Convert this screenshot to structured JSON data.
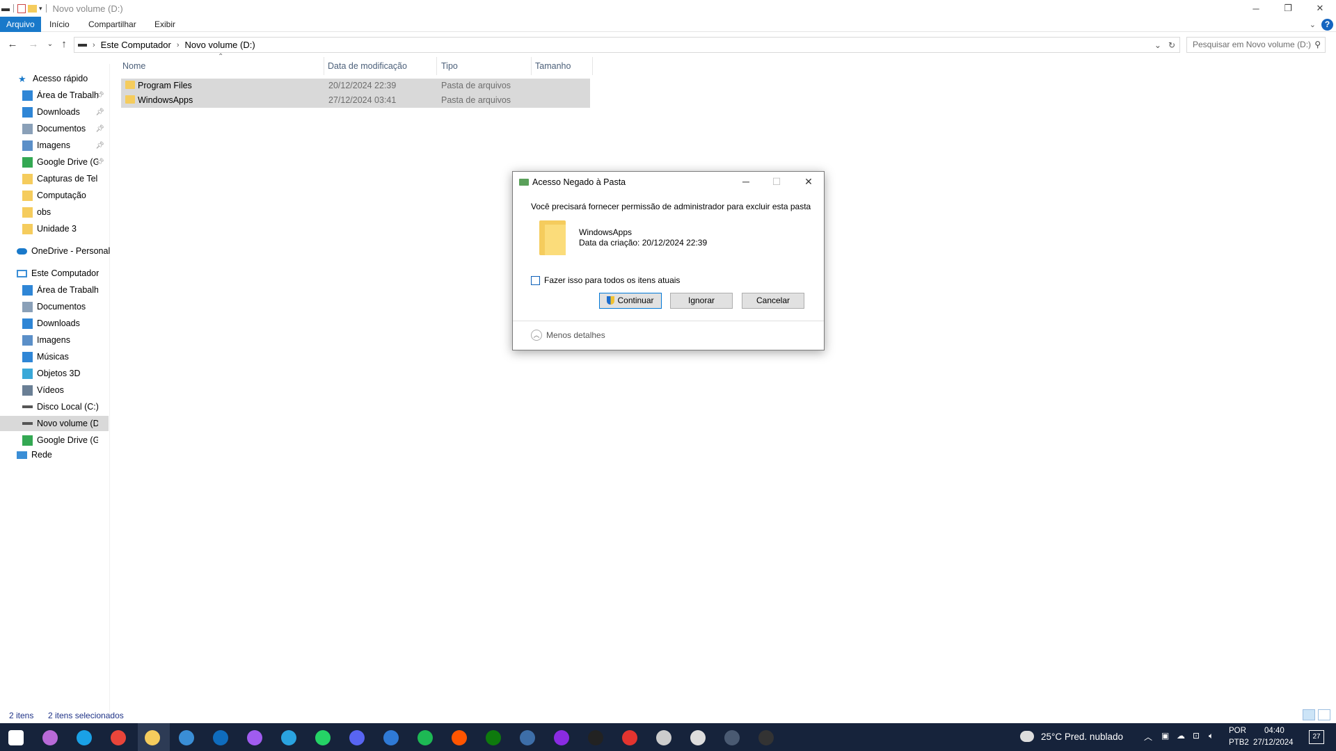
{
  "window": {
    "title": "Novo volume (D:)"
  },
  "ribbon": {
    "tabs": [
      "Arquivo",
      "Início",
      "Compartilhar",
      "Exibir"
    ],
    "help_label": "?"
  },
  "address": {
    "crumbs": [
      "Este Computador",
      "Novo volume (D:)"
    ],
    "search_placeholder": "Pesquisar em Novo volume (D:)"
  },
  "sidebar": {
    "quick_access_label": "Acesso rápido",
    "quick_access": [
      {
        "label": "Área de Trabalho",
        "icon": "desktop-icon",
        "pinned": true
      },
      {
        "label": "Downloads",
        "icon": "download-icon",
        "pinned": true
      },
      {
        "label": "Documentos",
        "icon": "documents-icon",
        "pinned": true
      },
      {
        "label": "Imagens",
        "icon": "pictures-icon",
        "pinned": true
      },
      {
        "label": "Google Drive (G:",
        "icon": "google-drive-icon",
        "pinned": true
      },
      {
        "label": "Capturas de Tela",
        "icon": "folder-icon",
        "pinned": false
      },
      {
        "label": "Computação",
        "icon": "folder-icon",
        "pinned": false
      },
      {
        "label": "obs",
        "icon": "folder-icon",
        "pinned": false
      },
      {
        "label": "Unidade 3",
        "icon": "folder-icon",
        "pinned": false
      }
    ],
    "onedrive_label": "OneDrive - Personal",
    "this_pc_label": "Este Computador",
    "this_pc": [
      {
        "label": "Área de Trabalho",
        "icon": "desktop-icon"
      },
      {
        "label": "Documentos",
        "icon": "documents-icon"
      },
      {
        "label": "Downloads",
        "icon": "download-icon"
      },
      {
        "label": "Imagens",
        "icon": "pictures-icon"
      },
      {
        "label": "Músicas",
        "icon": "music-icon"
      },
      {
        "label": "Objetos 3D",
        "icon": "3d-objects-icon"
      },
      {
        "label": "Vídeos",
        "icon": "videos-icon"
      },
      {
        "label": "Disco Local (C:)",
        "icon": "drive-icon"
      },
      {
        "label": "Novo volume (D:)",
        "icon": "drive-icon",
        "selected": true
      },
      {
        "label": "Google Drive (G:)",
        "icon": "google-drive-icon"
      }
    ],
    "network_label": "Rede"
  },
  "columns": [
    "Nome",
    "Data de modificação",
    "Tipo",
    "Tamanho"
  ],
  "files": [
    {
      "name": "Program Files",
      "date": "20/12/2024 22:39",
      "type": "Pasta de arquivos",
      "size": ""
    },
    {
      "name": "WindowsApps",
      "date": "27/12/2024 03:41",
      "type": "Pasta de arquivos",
      "size": ""
    }
  ],
  "status": {
    "count": "2 itens",
    "selected": "2 itens selecionados"
  },
  "dialog": {
    "title": "Acesso Negado à Pasta",
    "message": "Você precisará fornecer permissão de administrador para excluir esta pasta",
    "file_name": "WindowsApps",
    "file_created": "Data da criação: 20/12/2024 22:39",
    "checkbox_label": "Fazer isso para todos os itens atuais",
    "buttons": {
      "continue": "Continuar",
      "skip": "Ignorar",
      "cancel": "Cancelar"
    },
    "less_details": "Menos detalhes"
  },
  "taskbar": {
    "weather": "25°C  Pred. nublado",
    "lang1": "POR",
    "lang2": "PTB2",
    "time": "04:40",
    "date": "27/12/2024",
    "notif_count": "27",
    "apps": [
      "start",
      "copilot",
      "edge",
      "chrome",
      "file-explorer",
      "store",
      "outlook",
      "messenger",
      "telegram",
      "whatsapp",
      "discord",
      "video-editor",
      "spotify",
      "soundcloud",
      "xbox",
      "steam",
      "app-circle",
      "epic-games",
      "ea",
      "ubisoft",
      "clock",
      "calculator",
      "obs"
    ]
  },
  "colors": {
    "accent": "#1979ca",
    "taskbar": "#16233b",
    "selection": "#d9d9d9",
    "folder": "#f5cc5d"
  }
}
